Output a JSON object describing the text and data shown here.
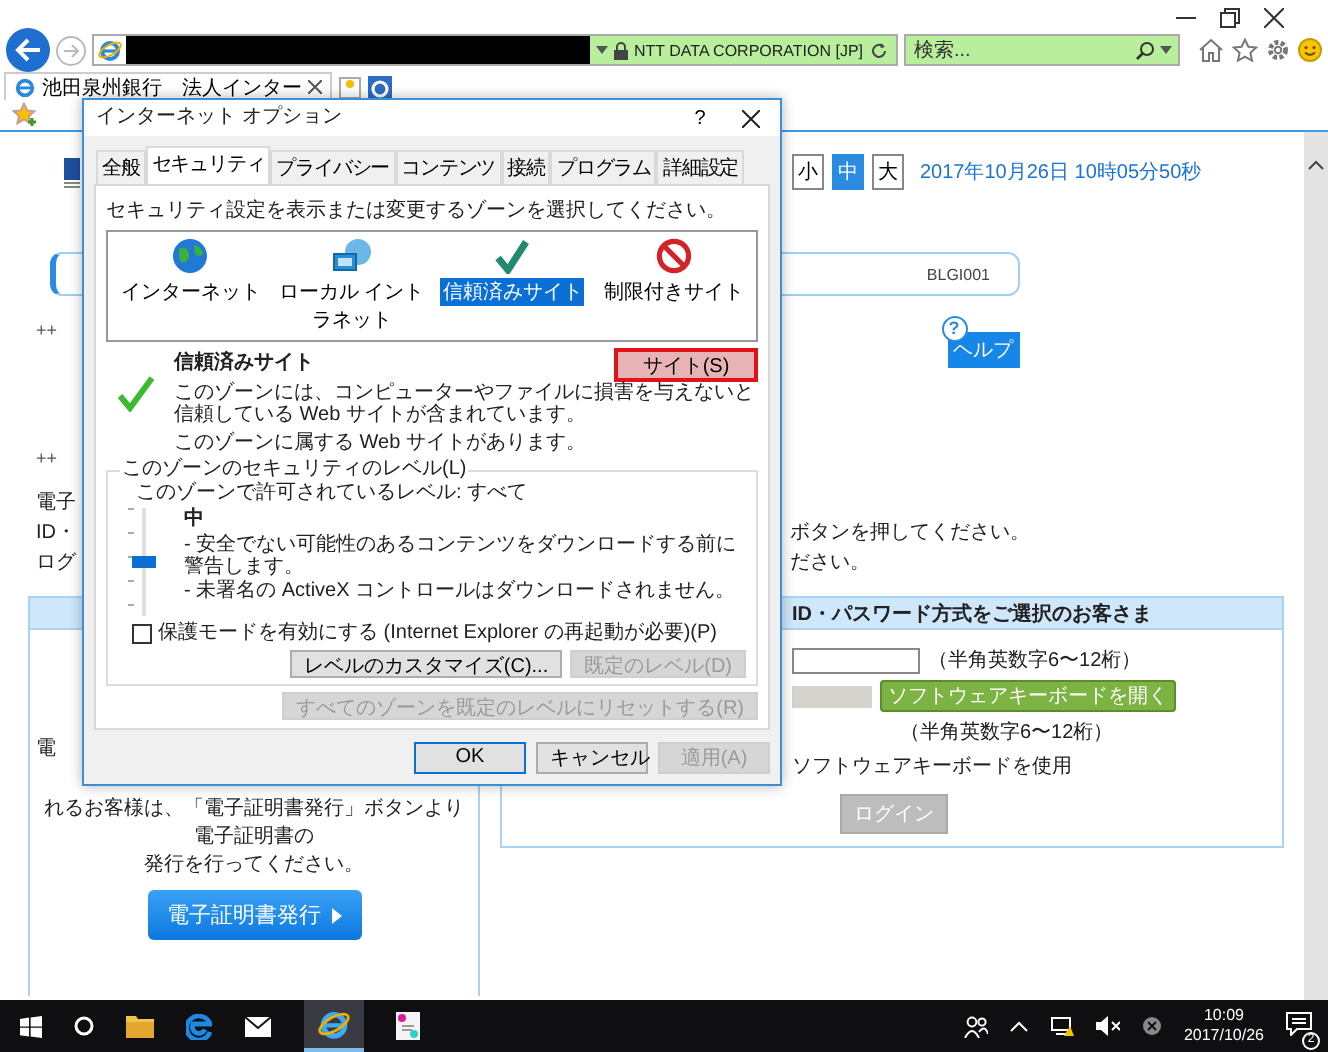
{
  "browser": {
    "identity": "NTT DATA CORPORATION [JP]",
    "search": {
      "placeholder": "検索..."
    },
    "tabs": [
      {
        "label": "池田泉州銀行　法人インター",
        "selected": true
      }
    ]
  },
  "page": {
    "text_sizes": [
      {
        "label": "小",
        "selected": false
      },
      {
        "label": "中",
        "selected": true
      },
      {
        "label": "大",
        "selected": false
      }
    ],
    "datetime": "2017年10月26日 10時05分50秒",
    "screen_id": "BLGI001",
    "help_mark": "?",
    "help_button": "ヘルプ",
    "markers": [
      "++",
      "++"
    ],
    "left_lines": [
      "電子",
      "ID・",
      "ログ"
    ],
    "right_lines": [
      "ボタンを押してください。",
      "ださい。"
    ],
    "cert_panel": {
      "lines": [
        "電",
        "れるお客様は、「電子証明書発行」ボタンより電子証明書の",
        "発行を行ってください。"
      ],
      "button": "電子証明書発行"
    },
    "login_panel": {
      "title": "ID・パスワード方式をご選択のお客さま",
      "id_hint": "（半角英数字6〜12桁）",
      "keyboard_button": "ソフトウェアキーボードを開く",
      "password_hint": "（半角英数字6〜12桁）",
      "use_keyboard": "ソフトウェアキーボードを使用",
      "login_button": "ログイン"
    }
  },
  "dialog": {
    "title": "インターネット オプション",
    "help": "?",
    "tabs": [
      {
        "label": "全般",
        "selected": false
      },
      {
        "label": "セキュリティ",
        "selected": true
      },
      {
        "label": "プライバシー",
        "selected": false
      },
      {
        "label": "コンテンツ",
        "selected": false
      },
      {
        "label": "接続",
        "selected": false
      },
      {
        "label": "プログラム",
        "selected": false
      },
      {
        "label": "詳細設定",
        "selected": false
      }
    ],
    "prompt": "セキュリティ設定を表示または変更するゾーンを選択してください。",
    "zones": [
      {
        "label": "インターネット",
        "selected": false
      },
      {
        "label": "ローカル イントラネット",
        "selected": false
      },
      {
        "label": "信頼済みサイト",
        "selected": true
      },
      {
        "label": "制限付きサイト",
        "selected": false
      }
    ],
    "zone_title": "信頼済みサイト",
    "zone_description": "このゾーンには、コンピューターやファイルに損害を与えないと信頼している Web サイトが含まれています。",
    "sites_button": {
      "label": "サイト(S)",
      "highlighted": true
    },
    "zone_note": "このゾーンに属する Web サイトがあります。",
    "level_group": {
      "legend": "このゾーンのセキュリティのレベル(L)",
      "allowed": "このゾーンで許可されているレベル: すべて",
      "level": 0.5,
      "level_name": "中",
      "bullets": [
        "- 安全でない可能性のあるコンテンツをダウンロードする前に警告します。",
        "- 未署名の ActiveX コントロールはダウンロードされません。"
      ],
      "protected_mode": {
        "label": "保護モードを有効にする (Internet Explorer の再起動が必要)(P)",
        "checked": false
      },
      "buttons": [
        {
          "label": "レベルのカスタマイズ(C)...",
          "disabled": false
        },
        {
          "label": "既定のレベル(D)",
          "disabled": true
        }
      ]
    },
    "reset_button": {
      "label": "すべてのゾーンを既定のレベルにリセットする(R)",
      "disabled": true
    },
    "buttons": [
      {
        "label": "OK",
        "disabled": false
      },
      {
        "label": "キャンセル",
        "disabled": false
      },
      {
        "label": "適用(A)",
        "disabled": true
      }
    ]
  },
  "taskbar": {
    "time": "10:09",
    "date": "2017/10/26",
    "notifications": "2"
  }
}
